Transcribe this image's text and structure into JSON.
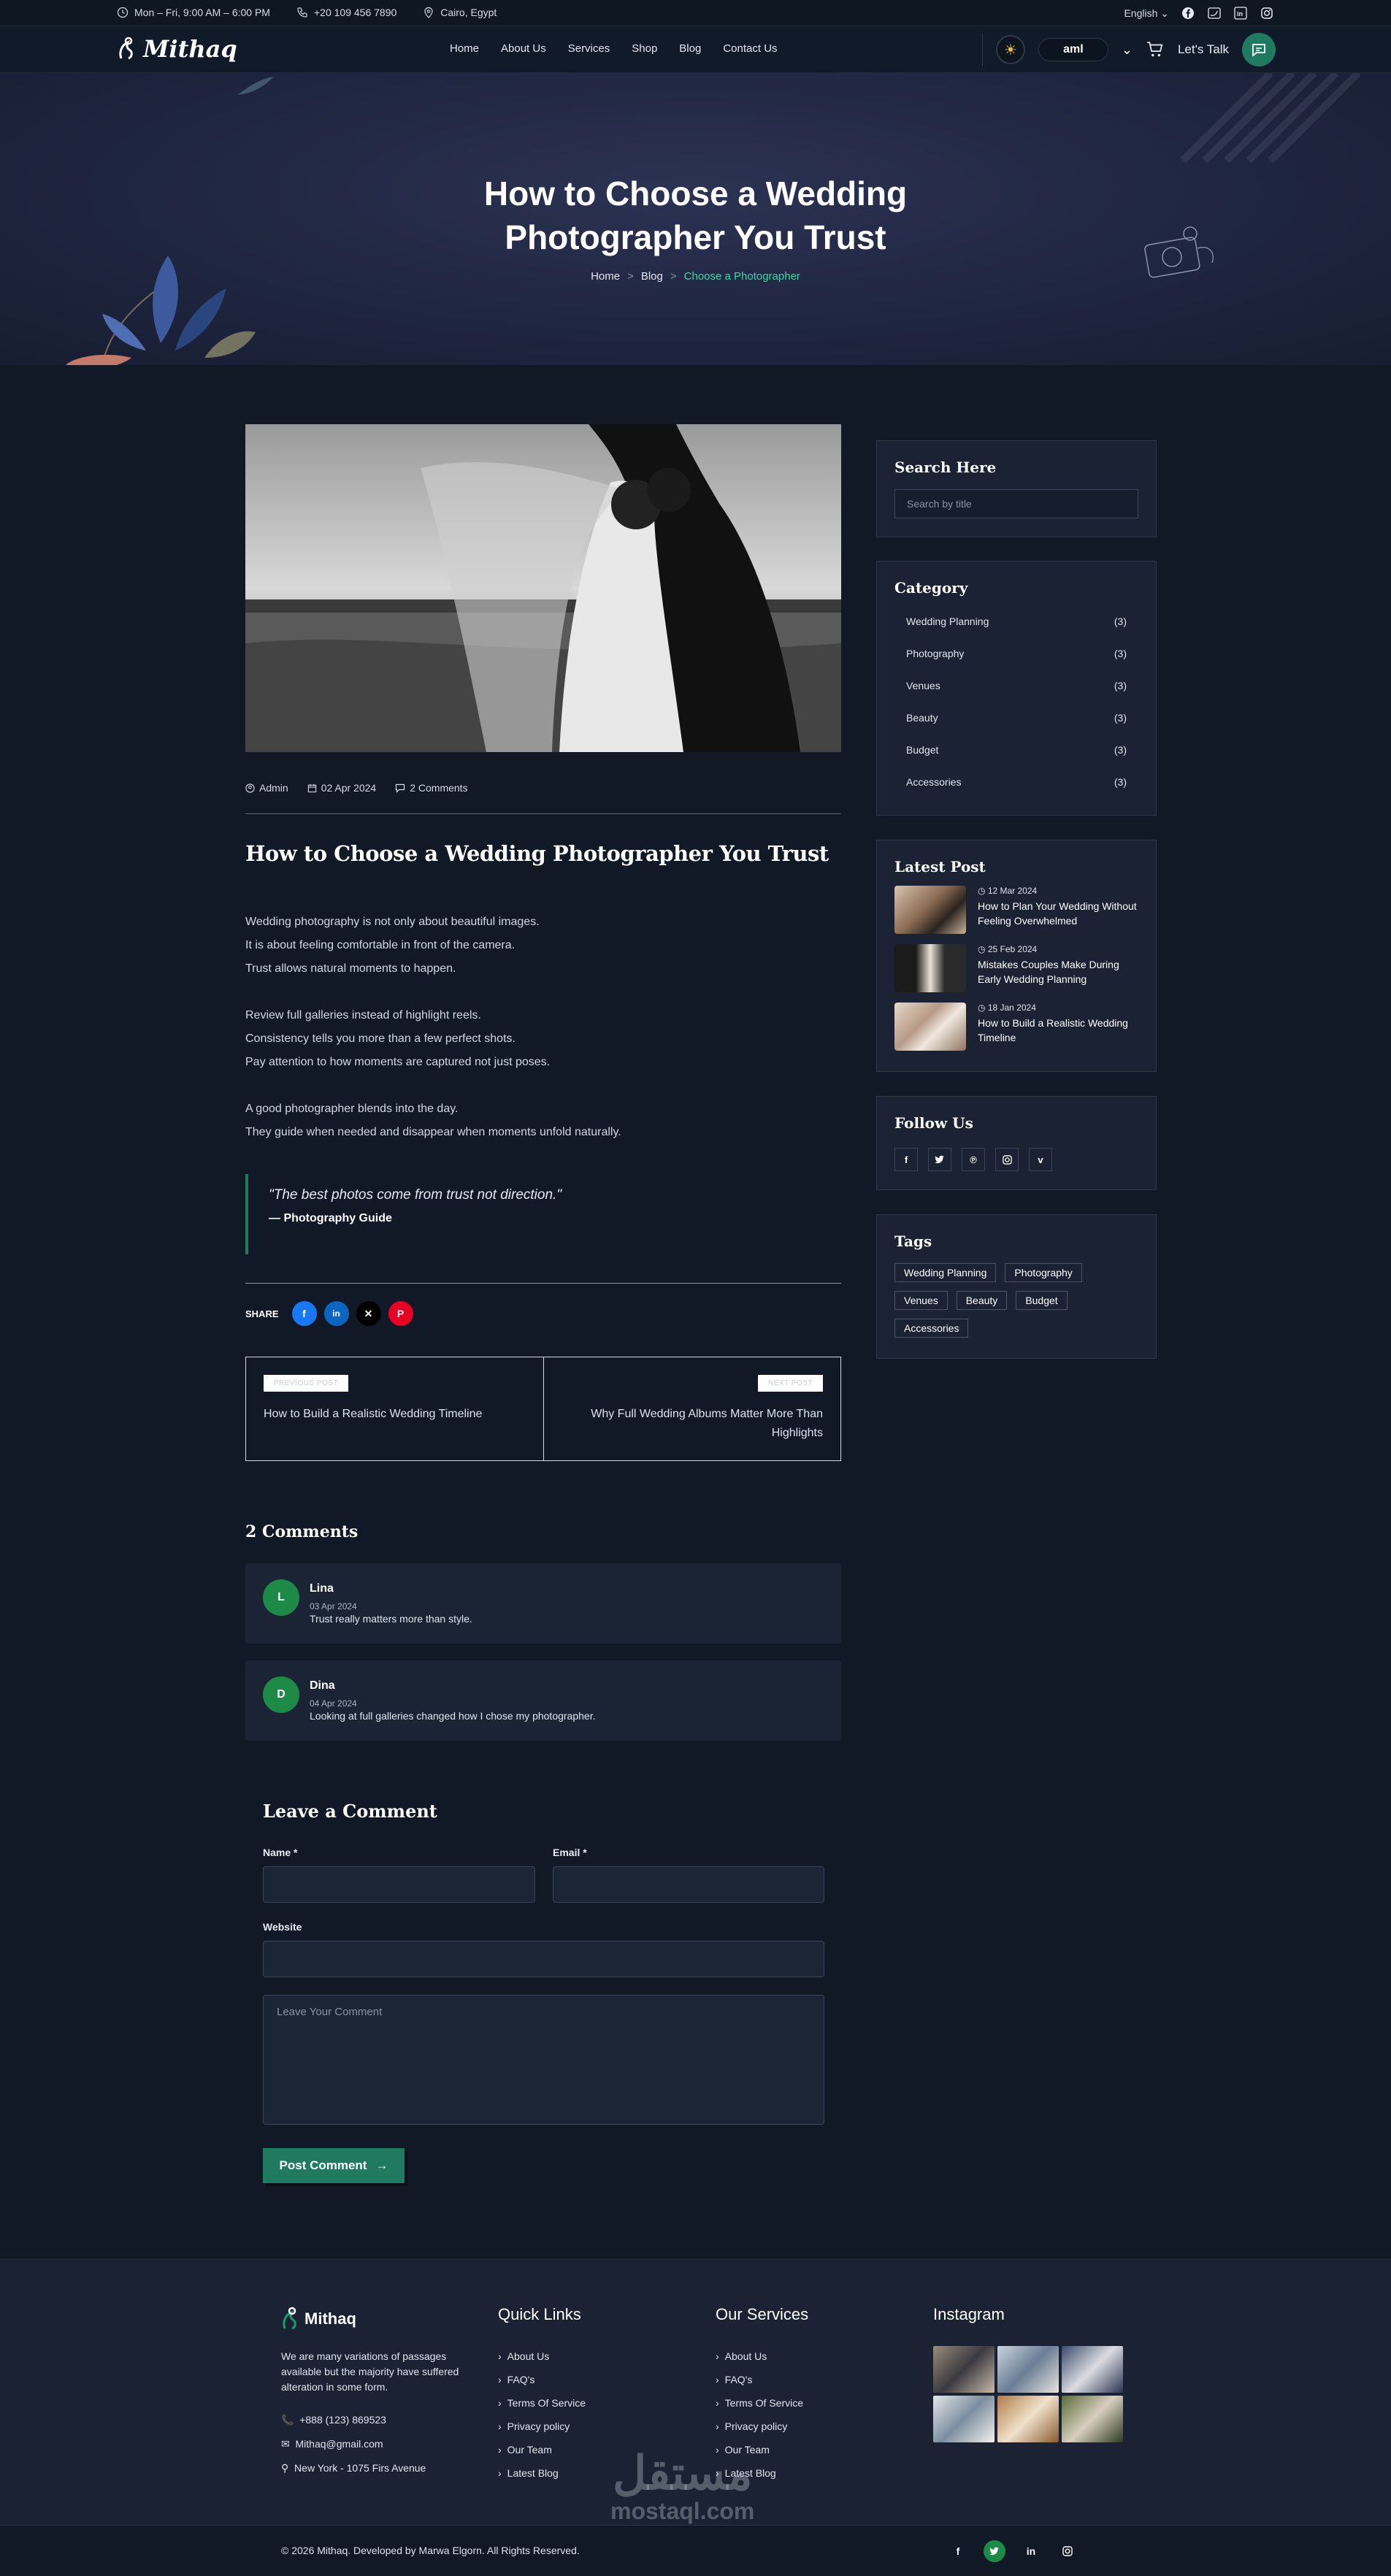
{
  "topbar": {
    "hours": "Mon – Fri, 9:00 AM – 6:00 PM",
    "phone": "+20 109 456 7890",
    "location": "Cairo, Egypt",
    "language": "English"
  },
  "nav": {
    "logo": "Mithaq",
    "menu": [
      "Home",
      "About Us",
      "Services",
      "Shop",
      "Blog",
      "Contact Us"
    ],
    "user_label": "aml",
    "cta": "Let's Talk"
  },
  "hero": {
    "title_line1": "How to Choose a Wedding",
    "title_line2": "Photographer You Trust",
    "breadcrumb": [
      "Home",
      "Blog",
      "Choose a Photographer"
    ]
  },
  "post": {
    "author": "Admin",
    "date": "02 Apr 2024",
    "comments": "2 Comments",
    "title": "How to Choose a Wedding Photographer You Trust",
    "paragraphs": [
      [
        "Wedding photography is not only about beautiful images.",
        "It is about feeling comfortable in front of the camera.",
        "Trust allows natural moments to happen."
      ],
      [
        "Review full galleries instead of highlight reels.",
        "Consistency tells you more than a few perfect shots.",
        "Pay attention to how moments are captured not just poses."
      ],
      [
        "A good photographer blends into the day.",
        "They guide when needed and disappear when moments unfold naturally."
      ]
    ],
    "quote": "\"The best photos come from trust not direction.\"",
    "quote_author": "— Photography Guide",
    "share_label": "SHARE",
    "prev_tag": "PREVIOUS POST",
    "prev_title": "How to Build a Realistic Wedding Timeline",
    "next_tag": "NEXT POST",
    "next_title": "Why Full Wedding Albums Matter More Than Highlights"
  },
  "comments": {
    "heading": "2 Comments",
    "items": [
      {
        "initial": "L",
        "name": "Lina",
        "date": "03 Apr 2024",
        "text": "Trust really matters more than style."
      },
      {
        "initial": "D",
        "name": "Dina",
        "date": "04 Apr 2024",
        "text": "Looking at full galleries changed how I chose my photographer."
      }
    ]
  },
  "form": {
    "heading": "Leave a Comment",
    "name_label": "Name *",
    "email_label": "Email *",
    "website_label": "Website",
    "comment_placeholder": "Leave Your Comment",
    "submit": "Post Comment"
  },
  "sidebar": {
    "search_title": "Search Here",
    "search_placeholder": "Search by title",
    "category_title": "Category",
    "categories": [
      {
        "name": "Wedding Planning",
        "count": "(3)"
      },
      {
        "name": "Photography",
        "count": "(3)"
      },
      {
        "name": "Venues",
        "count": "(3)"
      },
      {
        "name": "Beauty",
        "count": "(3)"
      },
      {
        "name": "Budget",
        "count": "(3)"
      },
      {
        "name": "Accessories",
        "count": "(3)"
      }
    ],
    "latest_title": "Latest Post",
    "latest": [
      {
        "date": "12 Mar 2024",
        "title": "How to Plan Your Wedding Without Feeling Overwhelmed"
      },
      {
        "date": "25 Feb 2024",
        "title": "Mistakes Couples Make During Early Wedding Planning"
      },
      {
        "date": "18 Jan 2024",
        "title": "How to Build a Realistic Wedding Timeline"
      }
    ],
    "follow_title": "Follow Us",
    "tags_title": "Tags",
    "tags": [
      "Wedding Planning",
      "Photography",
      "Venues",
      "Beauty",
      "Budget",
      "Accessories"
    ]
  },
  "footer": {
    "brand": "Mithaq",
    "about": "We are many variations of passages available but the majority have suffered alteration in some form.",
    "phone": "+888 (123) 869523",
    "email": "Mithaq@gmail.com",
    "address": "New York - 1075 Firs Avenue",
    "quick_title": "Quick Links",
    "quick_links": [
      "About Us",
      "FAQ's",
      "Terms Of Service",
      "Privacy policy",
      "Our Team",
      "Latest Blog"
    ],
    "services_title": "Our Services",
    "services_links": [
      "About Us",
      "FAQ's",
      "Terms Of Service",
      "Privacy policy",
      "Our Team",
      "Latest Blog"
    ],
    "instagram_title": "Instagram",
    "copyright": "© 2026 Mithaq. Developed by Marwa Elgorn. All Rights Reserved."
  },
  "watermark": {
    "arabic": "مستقل",
    "latin": "mostaql.com"
  },
  "colors": {
    "accent": "#3fd5a3",
    "primary": "#1f7a5f",
    "background": "#111927"
  }
}
